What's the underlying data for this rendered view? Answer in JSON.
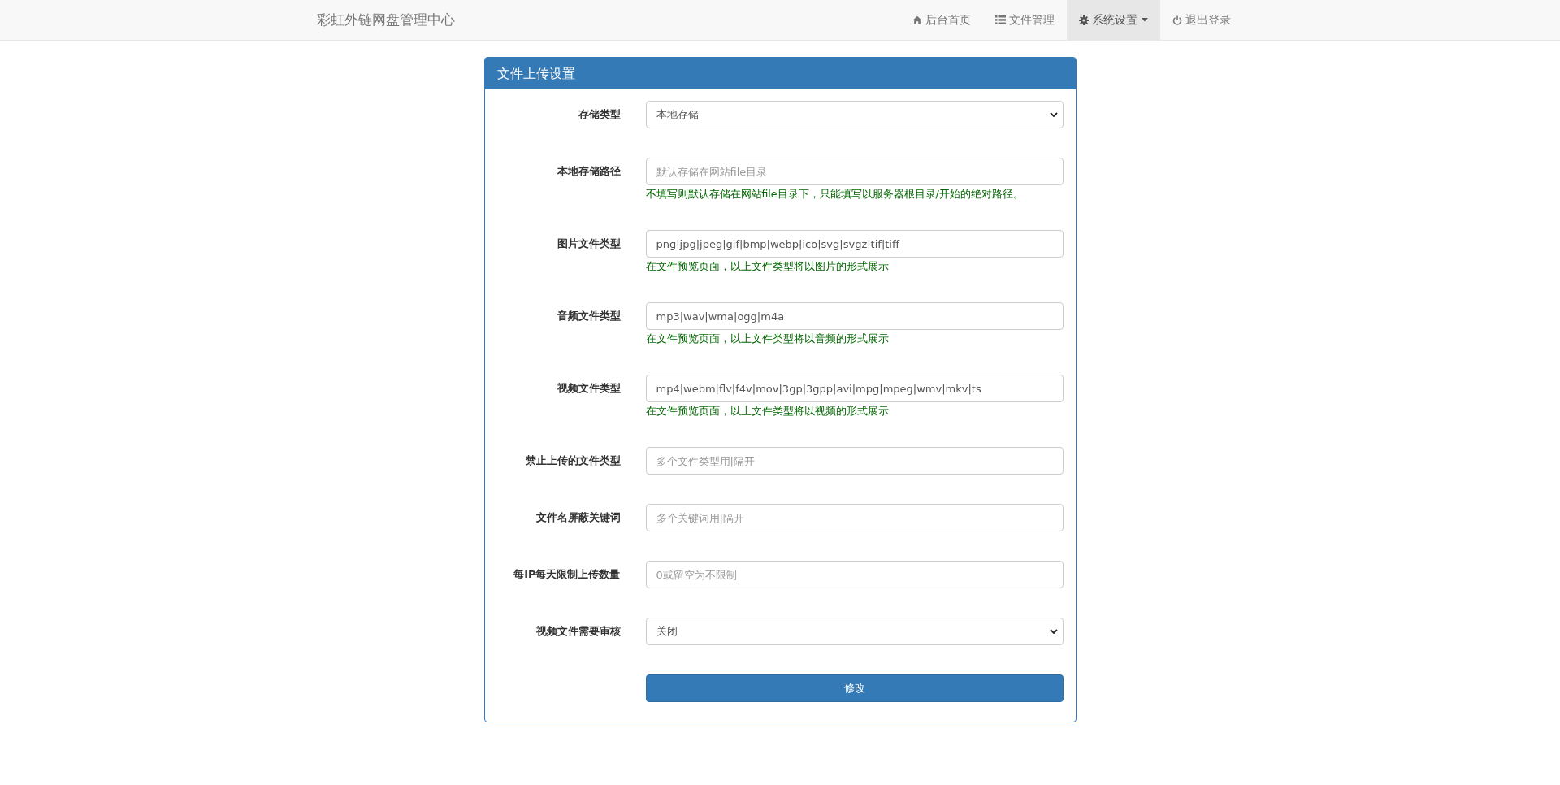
{
  "navbar": {
    "brand": "彩虹外链网盘管理中心",
    "items": [
      {
        "label": "后台首页",
        "selected": false,
        "dropdown": false
      },
      {
        "label": "文件管理",
        "selected": false,
        "dropdown": false
      },
      {
        "label": "系统设置",
        "selected": true,
        "dropdown": true
      },
      {
        "label": "退出登录",
        "selected": false,
        "dropdown": false
      }
    ]
  },
  "panel": {
    "title": "文件上传设置",
    "fields": [
      {
        "label": "存储类型",
        "kind": "select",
        "value": "本地存储"
      },
      {
        "label": "本地存储路径",
        "kind": "input",
        "placeholder": "默认存储在网站file目录",
        "help": "不填写则默认存储在网站file目录下，只能填写以服务器根目录/开始的绝对路径。"
      },
      {
        "label": "图片文件类型",
        "kind": "input",
        "value": "png|jpg|jpeg|gif|bmp|webp|ico|svg|svgz|tif|tiff",
        "help": "在文件预览页面，以上文件类型将以图片的形式展示"
      },
      {
        "label": "音频文件类型",
        "kind": "input",
        "value": "mp3|wav|wma|ogg|m4a",
        "help": "在文件预览页面，以上文件类型将以音频的形式展示"
      },
      {
        "label": "视频文件类型",
        "kind": "input",
        "value": "mp4|webm|flv|f4v|mov|3gp|3gpp|avi|mpg|mpeg|wmv|mkv|ts",
        "help": "在文件预览页面，以上文件类型将以视频的形式展示"
      },
      {
        "label": "禁止上传的文件类型",
        "kind": "input",
        "placeholder": "多个文件类型用|隔开"
      },
      {
        "label": "文件名屏蔽关键词",
        "kind": "input",
        "placeholder": "多个关键词用|隔开"
      },
      {
        "label": "每IP每天限制上传数量",
        "kind": "input",
        "placeholder": "0或留空为不限制"
      },
      {
        "label": "视频文件需要审核",
        "kind": "select",
        "value": "关闭"
      }
    ],
    "submit": "修改"
  }
}
